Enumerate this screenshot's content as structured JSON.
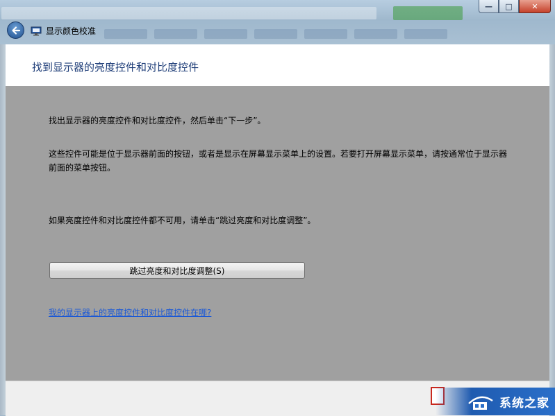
{
  "window": {
    "title": "显示颜色校准",
    "caption": {
      "minimize": "—",
      "maximize": "□",
      "close": "✕"
    }
  },
  "page": {
    "title": "找到显示器的亮度控件和对比度控件",
    "paragraph1": "找出显示器的亮度控件和对比度控件，然后单击“下一步”。",
    "paragraph2": "这些控件可能是位于显示器前面的按钮，或者是显示在屏幕显示菜单上的设置。若要打开屏幕显示菜单，请按通常位于显示器前面的菜单按钮。",
    "paragraph3": "如果亮度控件和对比度控件都不可用，请单击“跳过亮度和对比度调整”。",
    "skip_button": "跳过亮度和对比度调整(S)",
    "help_link": "我的显示器上的亮度控件和对比度控件在哪?"
  },
  "watermark": {
    "text": "系统之家"
  },
  "icons": [
    "back-arrow-icon",
    "monitor-icon",
    "minimize-icon",
    "maximize-icon",
    "close-icon",
    "watermark-logo-icon"
  ],
  "colors": {
    "title_text": "#1e3d78",
    "content_background": "#a0a0a0",
    "link": "#1a58d6",
    "close_button": "#c5412a"
  }
}
